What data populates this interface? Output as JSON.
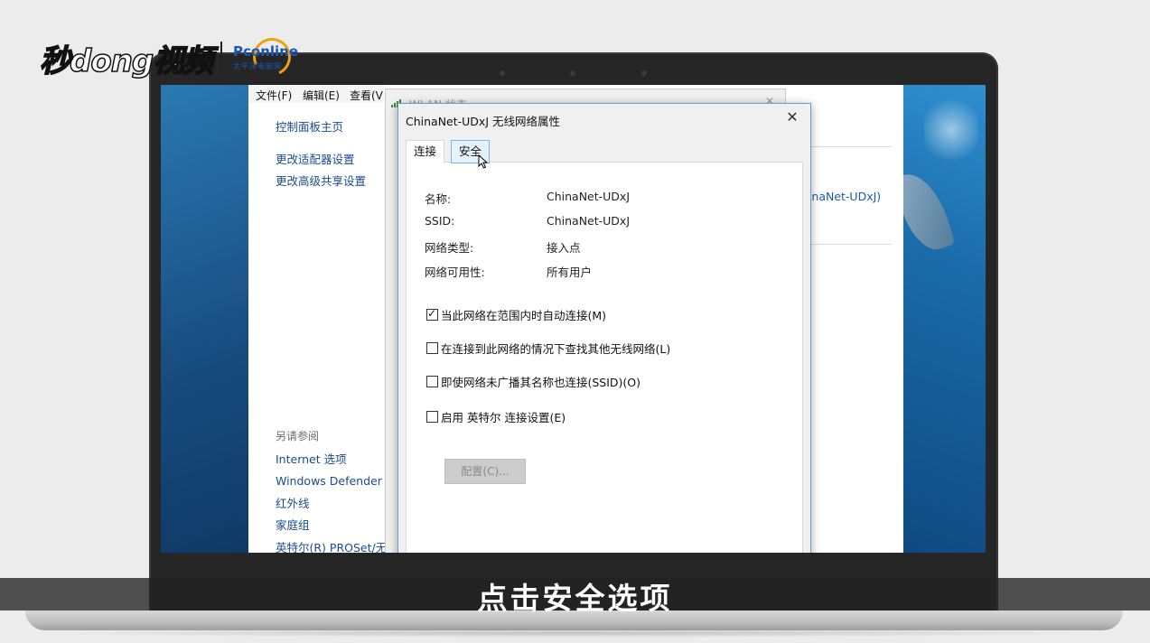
{
  "watermark": {
    "brand": "秒dong视频",
    "partner": "Pconline",
    "partner_tag": "太平洋电脑网"
  },
  "subtitle": "点击安全选项",
  "control_panel": {
    "menu": {
      "file": "文件(F)",
      "edit": "编辑(E)",
      "view": "查看(V"
    },
    "nav": [
      "控制面板主页",
      "更改适配器设置",
      "更改高级共享设置"
    ],
    "see_also_heading": "另请参阅",
    "see_also": [
      "Internet 选项",
      "Windows Defender 防火墙",
      "红外线",
      "家庭组",
      "英特尔(R) PROSet/无线工具"
    ],
    "right_link": "hinaNet-UDxJ)"
  },
  "wlan_status": {
    "title": "WLAN 状态"
  },
  "dialog": {
    "title": "ChinaNet-UDxJ 无线网络属性",
    "close_glyph": "✕",
    "tabs": [
      {
        "label": "连接",
        "state": "selected"
      },
      {
        "label": "安全",
        "state": "hover"
      }
    ],
    "properties": [
      {
        "label": "名称:",
        "value": "ChinaNet-UDxJ"
      },
      {
        "label": "SSID:",
        "value": "ChinaNet-UDxJ"
      },
      {
        "label": "网络类型:",
        "value": "接入点"
      },
      {
        "label": "网络可用性:",
        "value": "所有用户"
      }
    ],
    "options": [
      {
        "label": "当此网络在范围内时自动连接(M)",
        "checked": true
      },
      {
        "label": "在连接到此网络的情况下查找其他无线网络(L)",
        "checked": false
      },
      {
        "label": "即使网络未广播其名称也连接(SSID)(O)",
        "checked": false
      },
      {
        "label": "启用 英特尔 连接设置(E)",
        "checked": false
      }
    ],
    "configure_button": "配置(C)...",
    "check_glyph": "✓"
  },
  "colors": {
    "accent": "#1a5ca8",
    "window_border": "#6d9ed1",
    "tab_hover": "#e5f1fb"
  }
}
